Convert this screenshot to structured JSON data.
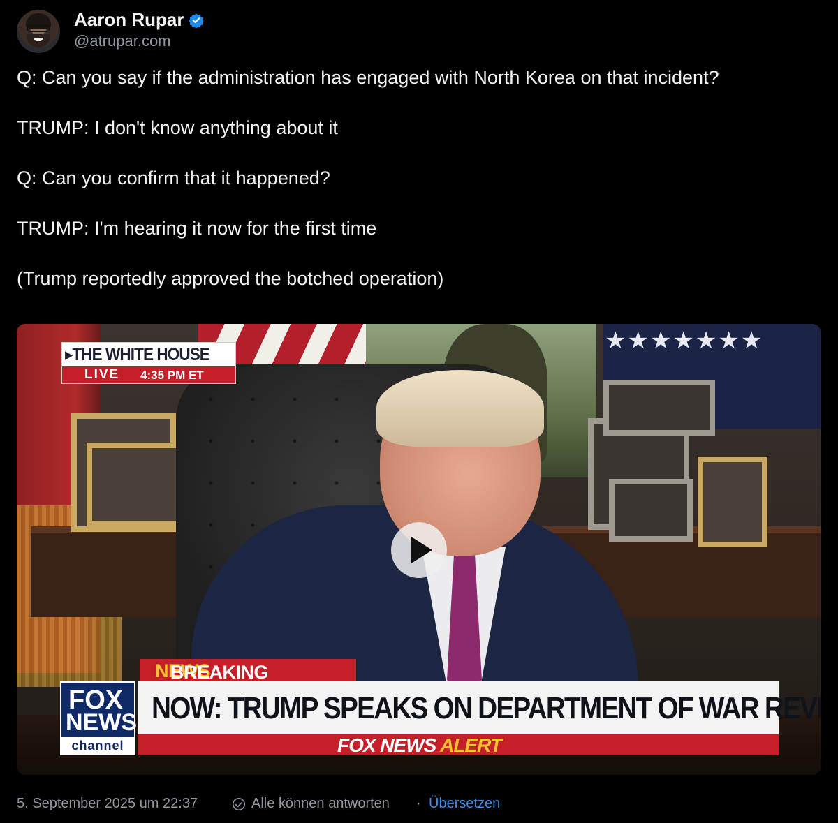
{
  "author": {
    "name": "Aaron Rupar",
    "handle": "@atrupar.com",
    "verified_color": "#1f8df0"
  },
  "post": {
    "lines": [
      "Q: Can you say if the administration has engaged with North Korea on that incident?",
      "TRUMP: I don't know anything about it",
      "Q: Can you confirm that it happened?",
      "TRUMP: I'm hearing it now for the first time",
      "(Trump reportedly approved the botched operation)"
    ]
  },
  "video": {
    "location_tag": "THE WHITE HOUSE",
    "live_label": "LIVE",
    "time": "4:35 PM ET",
    "breaking_label": "BREAKING",
    "breaking_news_word": "NEWS",
    "headline": "NOW: TRUMP SPEAKS ON DEPARTMENT OF WAR REVIVAL",
    "alert_prefix": "FOX NEWS",
    "alert_word": "ALERT",
    "logo_line1": "FOX",
    "logo_line2": "NEWS",
    "logo_line3": "channel",
    "play_icon": "play-icon"
  },
  "footer": {
    "timestamp": "5. September 2025 um 22:37",
    "reply_setting": "Alle können antworten",
    "separator": "·",
    "translate_label": "Übersetzen",
    "link_color": "#3b8fe8"
  }
}
